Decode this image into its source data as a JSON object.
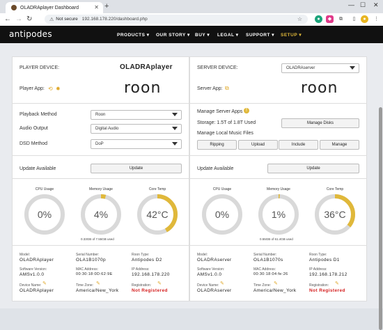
{
  "browser": {
    "tab_title": "OLADRAplayer Dashboard",
    "url_security": "Not secure",
    "url": "192.168.178.220/dashboard.php"
  },
  "nav": {
    "logo": "antipodes",
    "items": [
      "PRODUCTS",
      "OUR STORY",
      "BUY",
      "LEGAL",
      "SUPPORT",
      "SETUP"
    ]
  },
  "player": {
    "device_label": "PLAYER DEVICE:",
    "device_name": "OLADRAplayer",
    "app_label": "Player App:",
    "app_logo": "roon",
    "playback_label": "Playback Method",
    "playback_value": "Roon",
    "audio_label": "Audio Output",
    "audio_value": "Digital Audio",
    "dsd_label": "DSD Method",
    "dsd_value": "DoP",
    "update_label": "Update Available",
    "update_button": "Update",
    "gauges": [
      {
        "title": "CPU Usage",
        "value": "0%",
        "fill": 0
      },
      {
        "title": "Memory Usage",
        "value": "4%",
        "fill": 0.04
      },
      {
        "title": "Core Temp",
        "value": "42°C",
        "fill": 0.42
      }
    ],
    "memory_sub": "0.33GB of 7.55GB used",
    "info": {
      "model_key": "Model:",
      "model": "OLADRAplayer",
      "serial_key": "Serial Number:",
      "serial": "OLA1B1070p",
      "type_key": "Roon Type:",
      "type": "Antipodes D2",
      "sw_key": "Software Version:",
      "sw": "AMSv1.0.0",
      "mac_key": "MAC Address:",
      "mac": "00:30:18:0D:62:9E",
      "ip_key": "IP Address:",
      "ip": "192.168.178.220",
      "name_key": "Device Name:",
      "name": "OLADRAplayer",
      "tz_key": "Time Zone:",
      "tz": "America/New_York",
      "reg_key": "Registration:",
      "reg": "Not Registered"
    }
  },
  "server": {
    "device_label": "SERVER DEVICE:",
    "device_select": "OLADRAserver",
    "app_label": "Server App:",
    "app_logo": "roon",
    "manage_apps": "Manage Server Apps",
    "storage": "Storage: 1.5T of 1.8T Used",
    "manage_disks": "Manage Disks",
    "manage_music": "Manage Local Music Files",
    "buttons": [
      "Ripping",
      "Upload",
      "Include",
      "Manage"
    ],
    "update_label": "Update Available",
    "update_button": "Update",
    "gauges": [
      {
        "title": "CPU Usage",
        "value": "0%",
        "fill": 0
      },
      {
        "title": "Memory Usage",
        "value": "1%",
        "fill": 0.01
      },
      {
        "title": "Core Temp",
        "value": "36°C",
        "fill": 0.36
      }
    ],
    "memory_sub": "0.55GB of 61.4GB used",
    "info": {
      "model_key": "Model:",
      "model": "OLADRAserver",
      "serial_key": "Serial Number:",
      "serial": "OLA1B1070s",
      "type_key": "Roon Type:",
      "type": "Antipodes D1",
      "sw_key": "Software Version:",
      "sw": "AMSv1.0.0",
      "mac_key": "MAC Address:",
      "mac": "00:30:18:04:fe:26",
      "ip_key": "IP Address:",
      "ip": "192.168.178.212",
      "name_key": "Device Name:",
      "name": "OLADRAserver",
      "tz_key": "Time Zone:",
      "tz": "America/New_York",
      "reg_key": "Registration:",
      "reg": "Not Registered"
    }
  },
  "colors": {
    "accent": "#e0b83a",
    "gauge_track": "#d9d9d9",
    "danger": "#d41d1d"
  }
}
